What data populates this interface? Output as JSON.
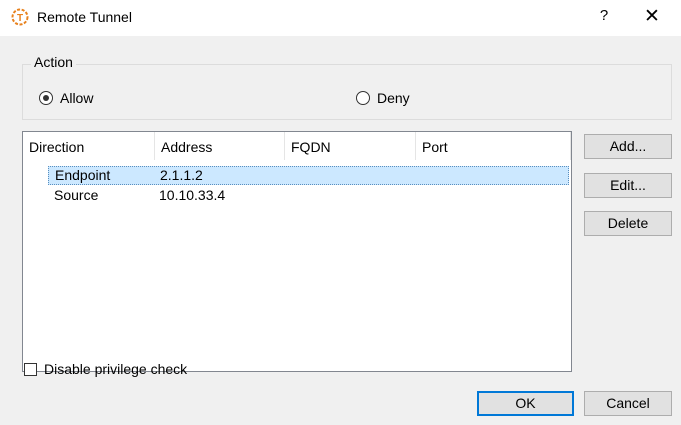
{
  "window": {
    "title": "Remote Tunnel",
    "help_glyph": "?",
    "close_glyph": "✕",
    "icon": "remote-tunnel-app-icon",
    "icon_letter": "T"
  },
  "action": {
    "group_label": "Action",
    "options": [
      {
        "label": "Allow",
        "selected": true
      },
      {
        "label": "Deny",
        "selected": false
      }
    ]
  },
  "table": {
    "columns": [
      "Direction",
      "Address",
      "FQDN",
      "Port"
    ],
    "rows": [
      {
        "direction": "Endpoint",
        "address": "2.1.1.2",
        "fqdn": "",
        "port": "",
        "selected": true
      },
      {
        "direction": "Source",
        "address": "10.10.33.4",
        "fqdn": "",
        "port": "",
        "selected": false
      }
    ]
  },
  "side_buttons": {
    "add": "Add...",
    "edit": "Edit...",
    "delete": "Delete"
  },
  "privilege_check": {
    "label": "Disable privilege check",
    "checked": false
  },
  "footer": {
    "ok": "OK",
    "cancel": "Cancel"
  },
  "colors": {
    "icon_orange": "#e8821e",
    "selection_bg": "#cce8ff",
    "default_button_border": "#0078d7"
  }
}
